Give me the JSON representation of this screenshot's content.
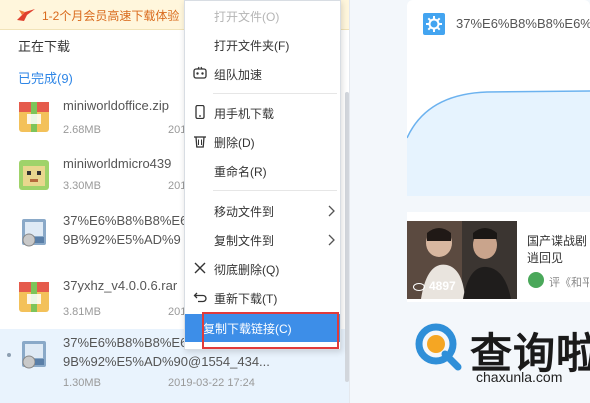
{
  "promo": {
    "text": "1-2个月会员高速下载体验"
  },
  "sections": {
    "downloading": "正在下载",
    "completed": "已完成(9)"
  },
  "files": [
    {
      "name": "miniworldoffice.zip",
      "size": "2.68MB",
      "date": "201",
      "icon": "zip-archive-icon"
    },
    {
      "name": "miniworldmicro439",
      "size": "3.30MB",
      "date": "201",
      "icon": "game-app-icon"
    },
    {
      "name": "37%E6%B8%B8%E6",
      "name2": "9B%92%E5%AD%9",
      "size": "",
      "date": "",
      "icon": "installer-icon"
    },
    {
      "name": "37yxhz_v4.0.0.6.rar",
      "size": "3.81MB",
      "date": "201",
      "icon": "rar-archive-icon"
    },
    {
      "name": "37%E6%B8%B8%E6",
      "name2": "9B%92%E5%AD%90@1554_434...",
      "size": "1.30MB",
      "date": "2019-03-22 17:24",
      "icon": "installer-icon",
      "selected": true
    }
  ],
  "menu": {
    "items": [
      {
        "label": "打开文件(O)",
        "disabled": true,
        "icon": ""
      },
      {
        "label": "打开文件夹(F)",
        "icon": ""
      },
      {
        "label": "组队加速",
        "icon": "team-accelerate-icon"
      },
      {
        "label": "用手机下载",
        "icon": "phone-icon"
      },
      {
        "label": "删除(D)",
        "icon": "trash-icon"
      },
      {
        "label": "重命名(R)",
        "icon": ""
      },
      {
        "label": "移动文件到",
        "icon": "",
        "submenu": true
      },
      {
        "label": "复制文件到",
        "icon": "",
        "submenu": true
      },
      {
        "label": "彻底删除(Q)",
        "icon": "x-icon"
      },
      {
        "label": "重新下载(T)",
        "icon": "redownload-icon"
      },
      {
        "label": "复制下载链接(C)",
        "icon": "",
        "highlighted": true
      }
    ]
  },
  "right_panel": {
    "card_title": "37%E6%B8%B8%E6%",
    "video": {
      "views": "4897",
      "title": "国产谍战剧逍回见",
      "source": "评《和平"
    },
    "watermark": {
      "brand": "查询啦",
      "domain": "chaxunla.com"
    }
  },
  "colors": {
    "accent": "#3d8ee8",
    "highlight_box": "#e03b3b",
    "promo_text": "#d96a1c",
    "completed": "#2f86e6"
  }
}
